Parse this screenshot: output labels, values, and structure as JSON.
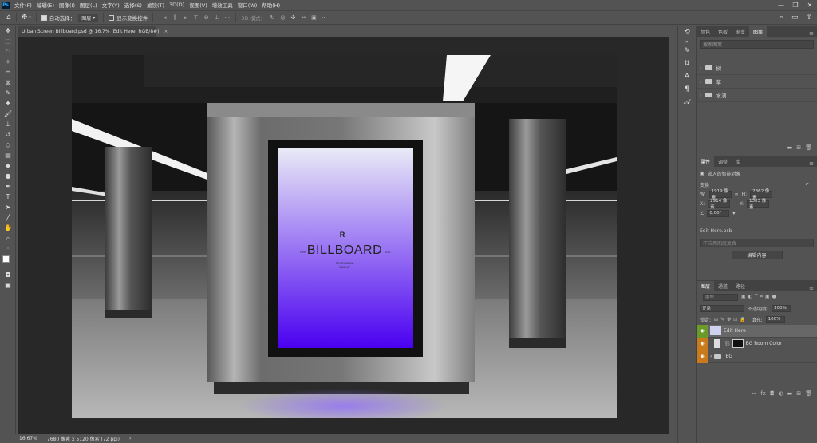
{
  "app": {
    "logo": "Ps"
  },
  "menu": [
    "文件(F)",
    "编辑(E)",
    "图像(I)",
    "图层(L)",
    "文字(Y)",
    "选择(S)",
    "滤镜(T)",
    "3D(D)",
    "视图(V)",
    "增效工具",
    "窗口(W)",
    "帮助(H)"
  ],
  "window_controls": [
    "—",
    "❐",
    "✕"
  ],
  "options": {
    "auto_select_label": "自动选择：",
    "auto_select_target": "图层",
    "show_transform_label": "显示变换控件",
    "mode_3d_label": "3D 模式："
  },
  "document": {
    "tab_title": "Urban Screen Billboard.psd @ 16.7% (Edit Here, RGB/8#)",
    "close_glyph": "×"
  },
  "status": {
    "zoom": "16.67%",
    "doc_info": "7680 像素 x 5120 像素 (72 ppi)"
  },
  "billboard": {
    "left_tag": "RVR",
    "title": "BILLBOARD",
    "right_tag": "EDIT",
    "subtitle1": "NEVER USUAL",
    "subtitle2": "MOCKUP",
    "colors": {
      "top": "#e9eaf6",
      "bottom": "#4a00f0"
    }
  },
  "panels": {
    "top_tabs": [
      "颜色",
      "色板",
      "渐变",
      "图案"
    ],
    "search_placeholder": "搜索图案",
    "folders": [
      "树",
      "草",
      "水滴"
    ],
    "props_tabs": [
      "属性",
      "调整",
      "库"
    ],
    "smart_object_label": "嵌入的智能对象",
    "transform_label": "变换",
    "w_label": "W:",
    "w_value": "1919 像素",
    "h_label": "H:",
    "h_value": "2862 像素",
    "x_label": "X:",
    "x_value": "2914 像素",
    "y_label": "Y:",
    "y_value": "1303 像素",
    "angle_value": "0.00°",
    "file_name": "Edit Here.psb",
    "comp_placeholder": "不应用图层复合",
    "edit_contents_btn": "编辑内容",
    "layers_tabs": [
      "图层",
      "通道",
      "路径"
    ],
    "kind_label": "类型",
    "blend_mode": "正常",
    "opacity_label": "不透明度:",
    "opacity_value": "100%",
    "lock_label": "锁定:",
    "fill_label": "填充:",
    "fill_value": "100%",
    "layers": [
      {
        "name": "Edit Here"
      },
      {
        "name": "BG Room Color"
      },
      {
        "name": "BG"
      }
    ]
  }
}
